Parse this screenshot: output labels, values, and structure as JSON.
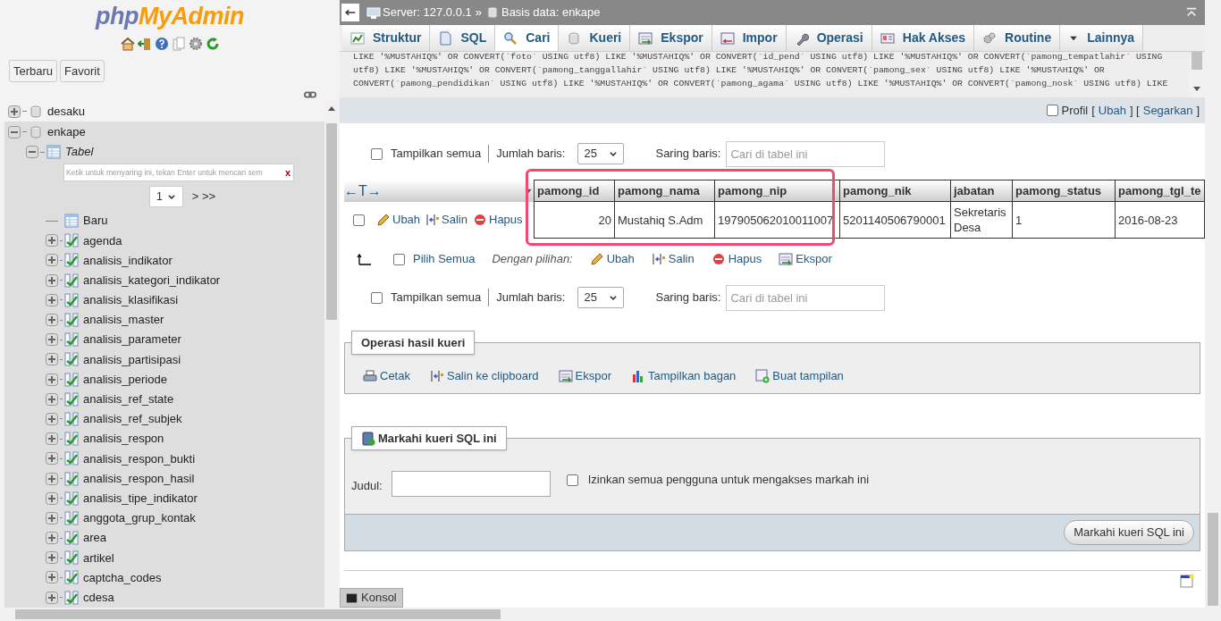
{
  "sidebar": {
    "logo": [
      "php",
      "MyAdmin"
    ],
    "buttons": [
      "Terbaru",
      "Favorit"
    ],
    "tree": [
      {
        "label": "desaku",
        "expanded": false
      },
      {
        "label": "enkape",
        "expanded": true,
        "children": [
          {
            "label": "Tabel",
            "expanded": true,
            "filter": {
              "placeholder": "Ketik untuk menyaring ini, tekan Enter untuk mencari sem",
              "clear": "x"
            },
            "pager": {
              "page": "1",
              "next": "> >>"
            },
            "children": [
              {
                "kind": "new",
                "label": "Baru"
              },
              {
                "kind": "table",
                "label": "agenda",
                "expanded": false
              },
              {
                "kind": "table",
                "label": "analisis_indikator",
                "expanded": false
              },
              {
                "kind": "table",
                "label": "analisis_kategori_indikator",
                "expanded": false
              },
              {
                "kind": "table",
                "label": "analisis_klasifikasi",
                "expanded": false
              },
              {
                "kind": "table",
                "label": "analisis_master",
                "expanded": false
              },
              {
                "kind": "table",
                "label": "analisis_parameter",
                "expanded": false
              },
              {
                "kind": "table",
                "label": "analisis_partisipasi",
                "expanded": false
              },
              {
                "kind": "table",
                "label": "analisis_periode",
                "expanded": false
              },
              {
                "kind": "table",
                "label": "analisis_ref_state",
                "expanded": false
              },
              {
                "kind": "table",
                "label": "analisis_ref_subjek",
                "expanded": false
              },
              {
                "kind": "table",
                "label": "analisis_respon",
                "expanded": false
              },
              {
                "kind": "table",
                "label": "analisis_respon_bukti",
                "expanded": false
              },
              {
                "kind": "table",
                "label": "analisis_respon_hasil",
                "expanded": false
              },
              {
                "kind": "table",
                "label": "analisis_tipe_indikator",
                "expanded": false
              },
              {
                "kind": "table",
                "label": "anggota_grup_kontak",
                "expanded": false
              },
              {
                "kind": "table",
                "label": "area",
                "expanded": false
              },
              {
                "kind": "table",
                "label": "artikel",
                "expanded": false
              },
              {
                "kind": "table",
                "label": "captcha_codes",
                "expanded": false
              },
              {
                "kind": "table",
                "label": "cdesa",
                "expanded": false
              }
            ]
          }
        ]
      }
    ]
  },
  "breadcrumb": {
    "server": "Server: 127.0.0.1",
    "separator": "»",
    "database": "Basis data: enkape"
  },
  "tabs": [
    {
      "label": "Struktur",
      "selected": false
    },
    {
      "label": "SQL",
      "selected": false
    },
    {
      "label": "Cari",
      "selected": true
    },
    {
      "label": "Kueri",
      "selected": false
    },
    {
      "label": "Ekspor",
      "selected": false
    },
    {
      "label": "Impor",
      "selected": false
    },
    {
      "label": "Operasi",
      "selected": false
    },
    {
      "label": "Hak Akses",
      "selected": false
    },
    {
      "label": "Routine",
      "selected": false
    },
    {
      "label": "Lainnya",
      "selected": false
    }
  ],
  "sql_lines": [
    "LIKE '%MUSTAHIQ%' OR CONVERT(`foto` USING utf8) LIKE '%MUSTAHIQ%' OR CONVERT(`id_pend` USING utf8) LIKE '%MUSTAHIQ%' OR CONVERT(`pamong_tempatlahir` USING",
    "utf8) LIKE '%MUSTAHIQ%' OR CONVERT(`pamong_tanggallahir` USING utf8) LIKE '%MUSTAHIQ%' OR CONVERT(`pamong_sex` USING utf8) LIKE '%MUSTAHIQ%' OR",
    "CONVERT(`pamong_pendidikan` USING utf8) LIKE '%MUSTAHIQ%' OR CONVERT(`pamong_agama` USING utf8) LIKE '%MUSTAHIQ%' OR CONVERT(`pamong_nosk` USING utf8) LIKE"
  ],
  "profil": {
    "label": "Profil",
    "checked": false,
    "open": "[",
    "edit": "Ubah",
    "mid": "] [",
    "refresh": "Segarkan",
    "close": "]"
  },
  "nav_bars": [
    {
      "show_all": "Tampilkan semua",
      "show_all_checked": false,
      "rows_label": "Jumlah baris:",
      "rows_value": "25",
      "filter_label": "Saring baris:",
      "filter_placeholder": "Cari di tabel ini"
    },
    {
      "show_all": "Tampilkan semua",
      "show_all_checked": false,
      "rows_label": "Jumlah baris:",
      "rows_value": "25",
      "filter_label": "Saring baris:",
      "filter_placeholder": "Cari di tabel ini"
    }
  ],
  "table": {
    "arrows": "←T→",
    "columns": [
      "pamong_id",
      "pamong_nama",
      "pamong_nip",
      "pamong_nik",
      "jabatan",
      "pamong_status",
      "pamong_tgl_te"
    ],
    "rows": [
      {
        "checked": false,
        "actions": [
          "Ubah",
          "Salin",
          "Hapus"
        ],
        "cells": [
          "20",
          "Mustahiq S.Adm",
          "197905062010011007",
          "5201140506790001",
          "Sekretaris Desa",
          "1",
          "2016-08-23"
        ]
      }
    ]
  },
  "with_selected": {
    "check_all": "Pilih Semua",
    "checked": false,
    "label": "Dengan pilihan:",
    "actions": [
      "Ubah",
      "Salin",
      "Hapus",
      "Ekspor"
    ]
  },
  "query_ops": {
    "legend": "Operasi hasil kueri",
    "actions": [
      "Cetak",
      "Salin ke clipboard",
      "Ekspor",
      "Tampilkan bagan",
      "Buat tampilan"
    ]
  },
  "bookmark": {
    "legend": "Markahi kueri SQL ini",
    "title_label": "Judul:",
    "share_label": "Izinkan semua pengguna untuk mengakses markah ini",
    "share_checked": false,
    "button": "Markahi kueri SQL ini"
  },
  "console": "Konsol"
}
